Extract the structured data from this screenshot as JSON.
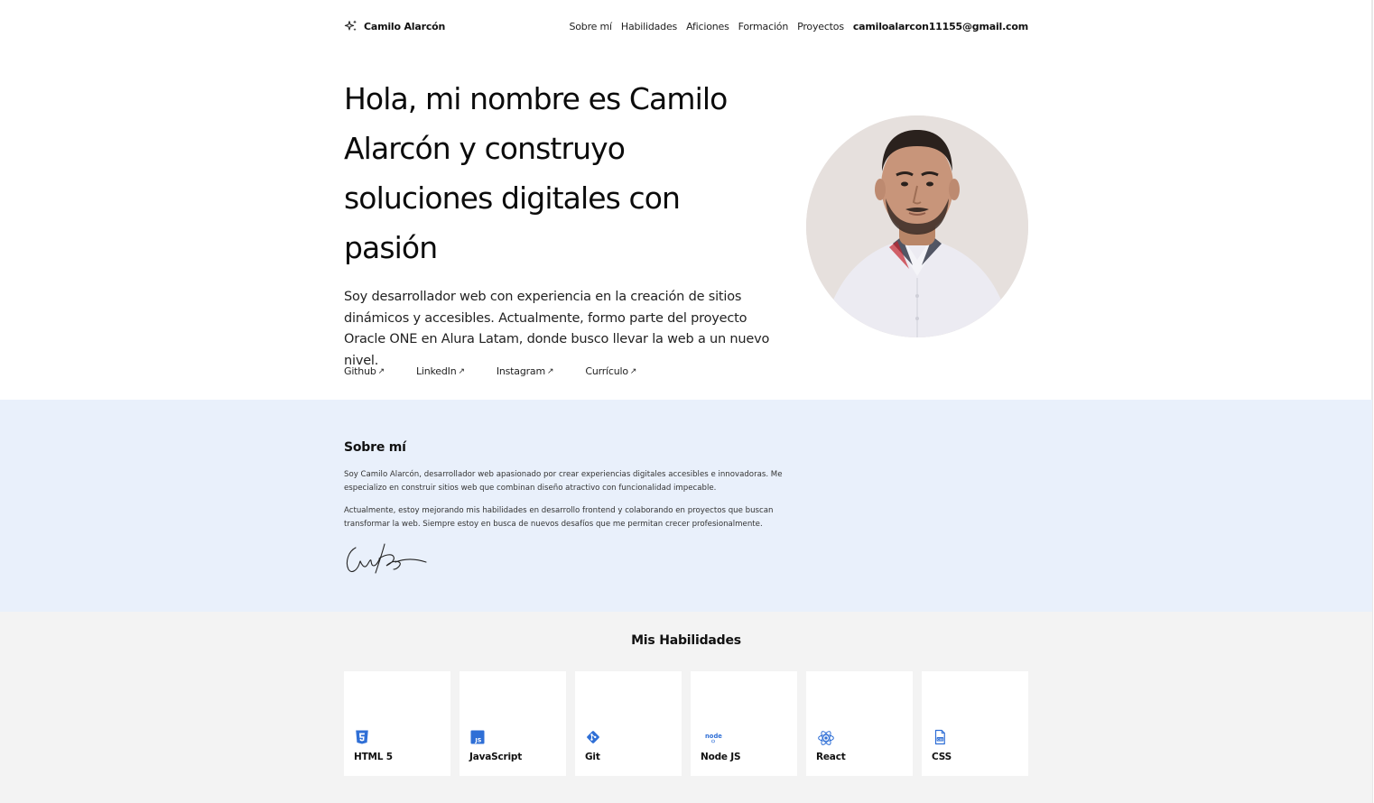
{
  "header": {
    "brand": "Camilo Alarcón",
    "nav": [
      "Sobre mí",
      "Habilidades",
      "Aficiones",
      "Formación",
      "Proyectos"
    ],
    "email": "camiloalarcon11155@gmail.com"
  },
  "hero": {
    "title": "Hola, mi nombre es Camilo Alarcón y construyo soluciones digitales con pasión",
    "description": "Soy desarrollador web con experiencia en la creación de sitios dinámicos y accesibles. Actualmente, formo parte del proyecto Oracle ONE en Alura Latam, donde busco llevar la web a un nuevo nivel.",
    "links": [
      "Github",
      "LinkedIn",
      "Instagram",
      "Currículo"
    ],
    "link_arrow": "↗"
  },
  "about": {
    "title": "Sobre mí",
    "paragraph1": "Soy Camilo Alarcón, desarrollador web apasionado por crear experiencias digitales accesibles e innovadoras. Me especializo en construir sitios web que combinan diseño atractivo con funcionalidad impecable.",
    "paragraph2": "Actualmente, estoy mejorando mis habilidades en desarrollo frontend y colaborando en proyectos que buscan transformar la web. Siempre estoy en busca de nuevos desafíos que me permitan crecer profesionalmente."
  },
  "skills": {
    "title": "Mis Habilidades",
    "items": [
      {
        "label": "HTML 5",
        "icon": "html5-icon"
      },
      {
        "label": "JavaScript",
        "icon": "javascript-icon"
      },
      {
        "label": "Git",
        "icon": "git-icon"
      },
      {
        "label": "Node JS",
        "icon": "nodejs-icon"
      },
      {
        "label": "React",
        "icon": "react-icon"
      },
      {
        "label": "CSS",
        "icon": "css-icon"
      }
    ]
  },
  "colors": {
    "about_bg": "#e9f0fb",
    "skills_bg": "#f3f3f3",
    "icon_blue": "#2f6fd6"
  }
}
